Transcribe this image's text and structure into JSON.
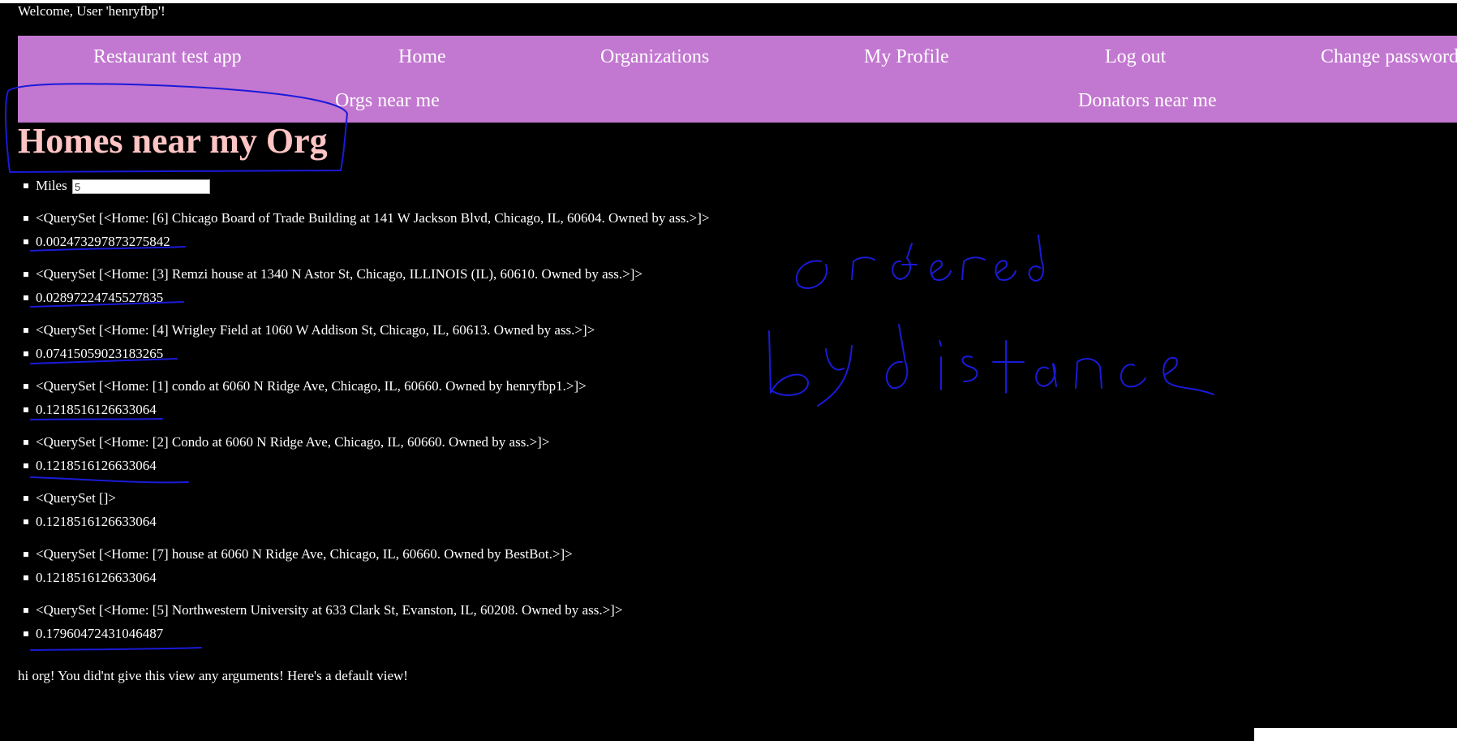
{
  "header": {
    "welcome": "Welcome, User 'henryfbp'!"
  },
  "nav": {
    "brand": "Restaurant test app",
    "home": "Home",
    "organizations": "Organizations",
    "my_profile": "My Profile",
    "log_out": "Log out",
    "change_password": "Change password",
    "orgs_near_me": "Orgs near me",
    "donators_near_me": "Donators near me"
  },
  "page": {
    "title": "Homes near my Org"
  },
  "form": {
    "miles_label": "Miles",
    "miles_value": "5"
  },
  "results": [
    {
      "home": "<QuerySet [<Home: [6] Chicago Board of Trade Building at 141 W Jackson Blvd, Chicago, IL, 60604. Owned by ass.>]>",
      "distance": "0.002473297873275842"
    },
    {
      "home": "<QuerySet [<Home: [3] Remzi house at 1340 N Astor St, Chicago, ILLINOIS (IL), 60610. Owned by ass.>]>",
      "distance": "0.02897224745527835"
    },
    {
      "home": "<QuerySet [<Home: [4] Wrigley Field at 1060 W Addison St, Chicago, IL, 60613. Owned by ass.>]>",
      "distance": "0.07415059023183265"
    },
    {
      "home": "<QuerySet [<Home: [1] condo at 6060 N Ridge Ave, Chicago, IL, 60660. Owned by henryfbp1.>]>",
      "distance": "0.1218516126633064"
    },
    {
      "home": "<QuerySet [<Home: [2] Condo at 6060 N Ridge Ave, Chicago, IL, 60660. Owned by ass.>]>",
      "distance": "0.1218516126633064"
    },
    {
      "home": "<QuerySet []>",
      "distance": "0.1218516126633064"
    },
    {
      "home": "<QuerySet [<Home: [7] house at 6060 N Ridge Ave, Chicago, IL, 60660. Owned by BestBot.>]>",
      "distance": "0.1218516126633064"
    },
    {
      "home": "<QuerySet [<Home: [5] Northwestern University at 633 Clark St, Evanston, IL, 60208. Owned by ass.>]>",
      "distance": "0.17960472431046487"
    }
  ],
  "footer": {
    "message": "hi org! You did'nt give this view any arguments! Here's a default view!"
  },
  "annotation": {
    "handwritten_line1": "ordered",
    "handwritten_line2": "by distance",
    "ink_color": "#1a1ad8"
  },
  "colors": {
    "nav_background": "#c277d0",
    "title_color": "#ffc4c4",
    "page_background": "#000000"
  }
}
